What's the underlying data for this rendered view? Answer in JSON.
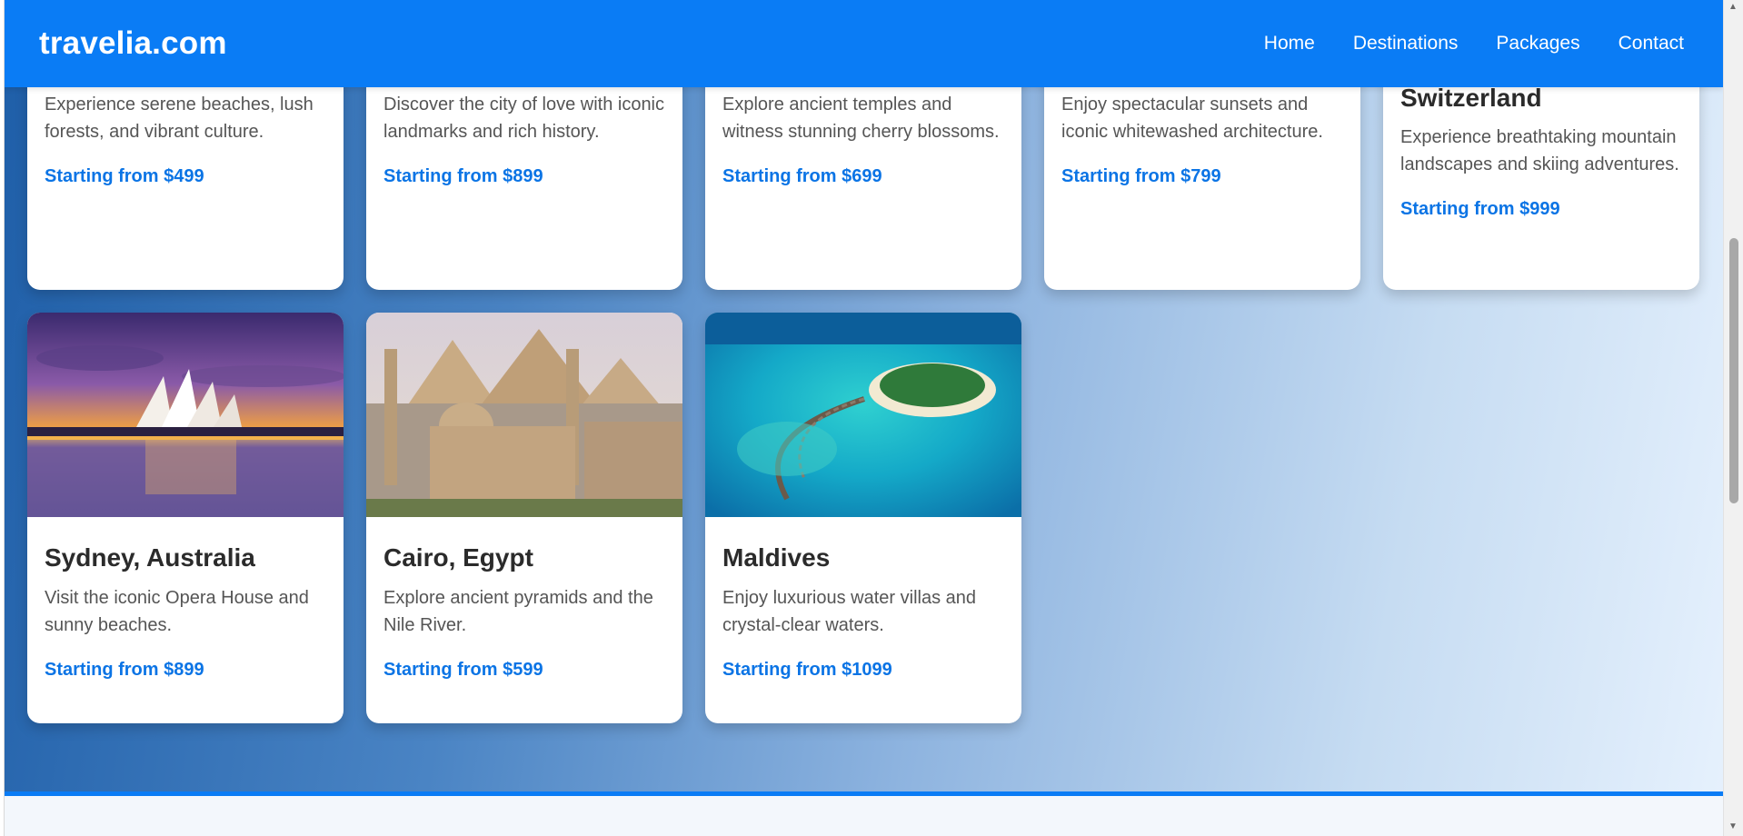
{
  "header": {
    "brand": "travelia.com",
    "nav": [
      "Home",
      "Destinations",
      "Packages",
      "Contact"
    ]
  },
  "cards_top": [
    {
      "title": "",
      "desc": "Experience serene beaches, lush forests, and vibrant culture.",
      "price": "Starting from $499"
    },
    {
      "title": "",
      "desc": "Discover the city of love with iconic landmarks and rich history.",
      "price": "Starting from $899"
    },
    {
      "title": "",
      "desc": "Explore ancient temples and witness stunning cherry blossoms.",
      "price": "Starting from $699"
    },
    {
      "title": "",
      "desc": "Enjoy spectacular sunsets and iconic whitewashed architecture.",
      "price": "Starting from $799"
    },
    {
      "title": "Switzerland",
      "desc": "Experience breathtaking mountain landscapes and skiing adventures.",
      "price": "Starting from $999"
    }
  ],
  "cards_bottom": [
    {
      "title": "Sydney, Australia",
      "desc": "Visit the iconic Opera House and sunny beaches.",
      "price": "Starting from $899",
      "image": "sydney-opera-house-sunset"
    },
    {
      "title": "Cairo, Egypt",
      "desc": "Explore ancient pyramids and the Nile River.",
      "price": "Starting from $599",
      "image": "cairo-pyramids-mosque"
    },
    {
      "title": "Maldives",
      "desc": "Enjoy luxurious water villas and crystal-clear waters.",
      "price": "Starting from $1099",
      "image": "maldives-island-villas"
    }
  ],
  "colors": {
    "accent": "#0a7cf5",
    "price": "#0b74e5"
  }
}
